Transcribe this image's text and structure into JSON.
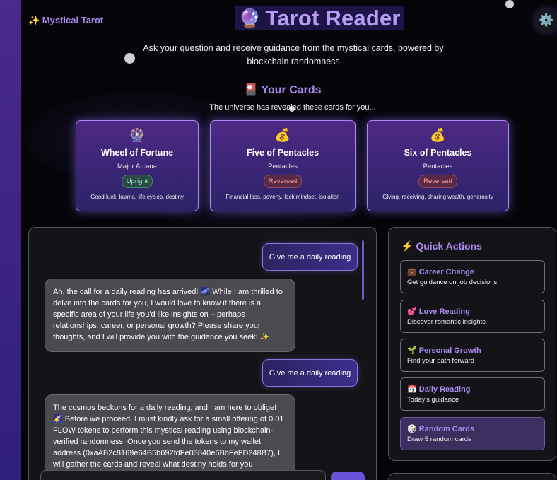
{
  "brand": "✨ Mystical Tarot",
  "settings_icon": "⚙️",
  "header": {
    "title_icon": "🔮",
    "title": "Tarot Reader",
    "subtitle": "Ask your question and receive guidance from the mystical cards, powered by blockchain randomness"
  },
  "cards_section": {
    "heading": "🎴 Your Cards",
    "subheading": "The universe has revealed these cards for you...",
    "cards": [
      {
        "icon": "🎡",
        "name": "Wheel of Fortune",
        "suit": "Major Arcana",
        "orientation": "Upright",
        "meaning": "Good luck, karma, life cycles, destiny"
      },
      {
        "icon": "💰",
        "name": "Five of Pentacles",
        "suit": "Pentacles",
        "orientation": "Reversed",
        "meaning": "Financial loss, poverty, lack mindset, isolation"
      },
      {
        "icon": "💰",
        "name": "Six of Pentacles",
        "suit": "Pentacles",
        "orientation": "Reversed",
        "meaning": "Giving, receiving, sharing wealth, generosity"
      }
    ]
  },
  "chat": {
    "messages": [
      {
        "role": "user",
        "text": "Give me a daily reading"
      },
      {
        "role": "bot",
        "text": "Ah, the call for a daily reading has arrived! 🌌 While I am thrilled to delve into the cards for you, I would love to know if there is a specific area of your life you'd like insights on – perhaps relationships, career, or personal growth? Please share your thoughts, and I will provide you with the guidance you seek! ✨"
      },
      {
        "role": "user",
        "text": "Give me a daily reading"
      },
      {
        "role": "bot",
        "text": "The cosmos beckons for a daily reading, and I am here to oblige! 🌠 Before we proceed, I must kindly ask for a small offering of 0.01 FLOW tokens to perform this mystical reading using blockchain-verified randomness. Once you send the tokens to my wallet address (0xaAB2c8169e64B5b692fdFe03840e6BbFeFD248B7), I will gather the cards and reveal what destiny holds for you"
      }
    ]
  },
  "quick_actions": {
    "title": "⚡ Quick Actions",
    "items": [
      {
        "name": "💼 Career Change",
        "desc": "Get guidance on job decisions"
      },
      {
        "name": "💕 Love Reading",
        "desc": "Discover romantic insights"
      },
      {
        "name": "🌱 Personal Growth",
        "desc": "Find your path forward"
      },
      {
        "name": "📅 Daily Reading",
        "desc": "Today's guidance"
      },
      {
        "name": "🎲 Random Cards",
        "desc": "Draw 5 random cards"
      }
    ]
  }
}
